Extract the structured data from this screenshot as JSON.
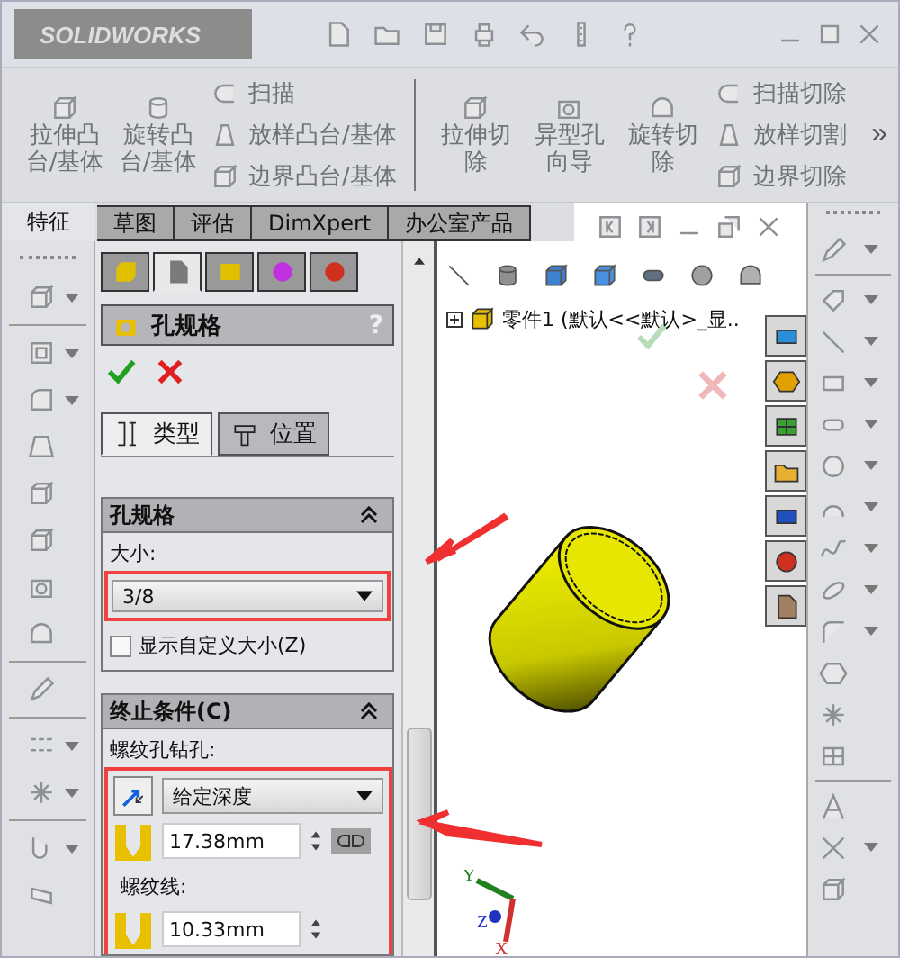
{
  "title_bar": {
    "logo": "SOLIDWORKS"
  },
  "ribbon": {
    "large_left": [
      "拉伸凸台/基体",
      "旋转凸台/基体"
    ],
    "small_left": [
      "扫描",
      "放样凸台/基体",
      "边界凸台/基体"
    ],
    "large_right": [
      "拉伸切除",
      "异型孔向导",
      "旋转切除"
    ],
    "small_right": [
      "扫描切除",
      "放样切割",
      "边界切除"
    ],
    "more": "»"
  },
  "tabs": [
    {
      "label": "特征",
      "selected": true
    },
    {
      "label": "草图",
      "selected": false
    },
    {
      "label": "评估",
      "selected": false
    },
    {
      "label": "DimXpert",
      "selected": false
    },
    {
      "label": "办公室产品",
      "selected": false
    }
  ],
  "property_manager": {
    "icon_tabs": [
      {
        "selected": false
      },
      {
        "selected": true
      },
      {
        "selected": false
      },
      {
        "selected": false
      },
      {
        "selected": false
      }
    ],
    "title": "孔规格",
    "help": "?",
    "subtabs": [
      {
        "label": "类型",
        "selected": true
      },
      {
        "label": "位置",
        "selected": false
      }
    ],
    "hole_spec": {
      "title": "孔规格",
      "size_label": "大小:",
      "size": "3/8",
      "custom_size": {
        "label": "显示自定义大小(Z)",
        "checked": false
      }
    },
    "end_condition": {
      "title": "终止条件(C)",
      "drill_label": "螺纹孔钻孔:",
      "type": "给定深度",
      "depth": "17.38mm",
      "thread_label": "螺纹线:",
      "thread_depth": "10.33mm"
    }
  },
  "graphics": {
    "tree_item": "零件1 (默认<<默认>_显..",
    "triad": [
      "Y",
      "Z",
      "X"
    ]
  }
}
